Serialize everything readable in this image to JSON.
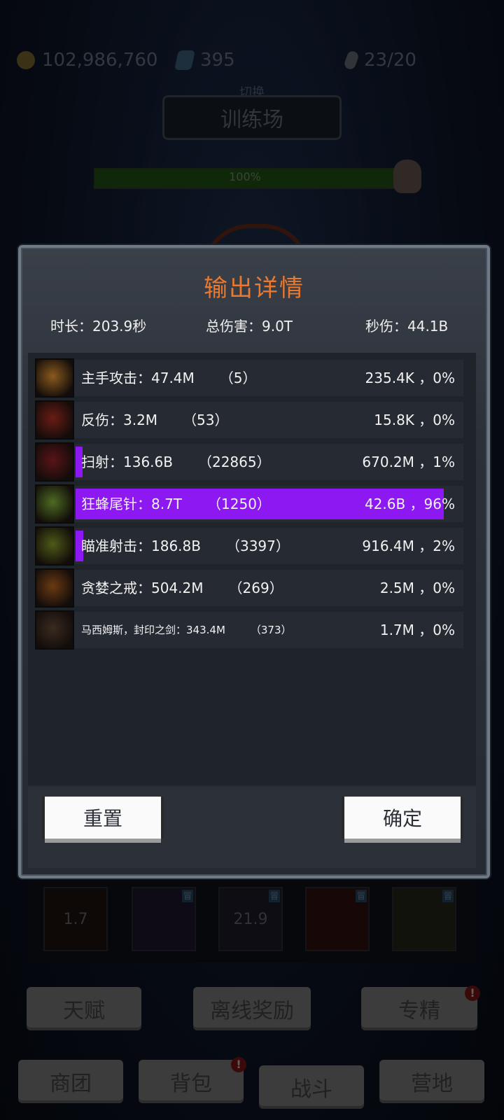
{
  "background": {
    "gold": "102,986,760",
    "gems": "395",
    "stamina": "23/20",
    "switch_label": "切换",
    "venue": "训练场",
    "boss_hp": "100%",
    "skills": [
      {
        "label": "1.7",
        "tag": ""
      },
      {
        "label": "",
        "tag": "冒"
      },
      {
        "label": "21.9",
        "tag": "冒"
      },
      {
        "label": "",
        "tag": "冒"
      },
      {
        "label": "",
        "tag": "冒"
      }
    ],
    "buttons": [
      "天赋",
      "离线奖励",
      "专精"
    ],
    "nav": [
      "商团",
      "背包",
      "战斗",
      "营地"
    ],
    "badge": "!"
  },
  "modal": {
    "title": "输出详情",
    "duration": "时长：203.9秒",
    "total_damage": "总伤害：9.0T",
    "dps": "秒伤：44.1B",
    "rows": [
      {
        "name": "主手攻击：47.4M",
        "hits": "（5）",
        "right": "235.4K ，0%",
        "percent": 0,
        "icon": "sword-icon",
        "color": "#8a5a1e"
      },
      {
        "name": "反伤：3.2M",
        "hits": "（53）",
        "right": "15.8K ，0%",
        "percent": 0,
        "icon": "thorns-icon",
        "color": "#6a1c14"
      },
      {
        "name": "扫射：136.6B",
        "hits": "（22865）",
        "right": "670.2M ，1%",
        "percent": 1,
        "icon": "crossbow-icon",
        "color": "#5a1417"
      },
      {
        "name": "狂蜂尾针：8.7T",
        "hits": "（1250）",
        "right": "42.6B ，96%",
        "percent": 96,
        "icon": "wasp-icon",
        "color": "#4d6b22"
      },
      {
        "name": "瞄准射击：186.8B",
        "hits": "（3397）",
        "right": "916.4M ，2%",
        "percent": 2,
        "icon": "bow-icon",
        "color": "#4e5a17"
      },
      {
        "name": "贪婪之戒：504.2M",
        "hits": "（269）",
        "right": "2.5M ，0%",
        "percent": 0,
        "icon": "ring-icon",
        "color": "#6a3a12"
      },
      {
        "name": "马西姆斯，封印之剑：343.4M",
        "hits": "（373）",
        "right": "1.7M ，0%",
        "percent": 0,
        "icon": "sealed-sword-icon",
        "color": "#3a2a20",
        "small": true
      }
    ],
    "reset_label": "重置",
    "confirm_label": "确定"
  },
  "colors": {
    "title": "#e8792f",
    "bar": "#8d18f2"
  }
}
